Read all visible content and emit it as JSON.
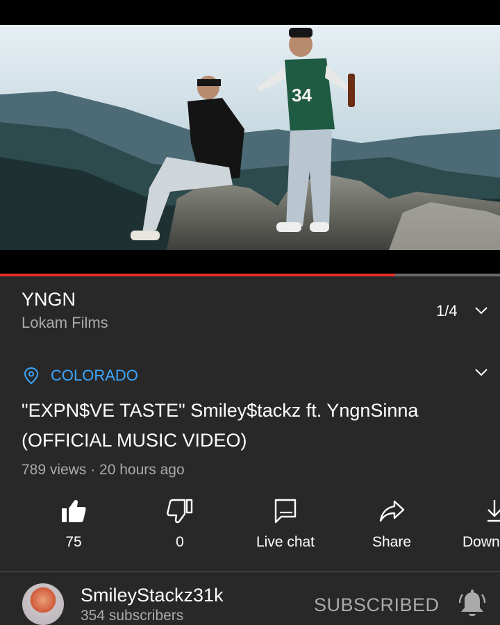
{
  "player": {
    "progress_fraction": 0.79
  },
  "playlist": {
    "title": "YNGN",
    "channel": "Lokam Films",
    "index": "1/4"
  },
  "video": {
    "location": "COLORADO",
    "title": "\"EXPN$VE TASTE\" Smiley$tackz ft. YngnSinna (OFFICIAL MUSIC VIDEO)",
    "meta": "789 views · 20 hours ago"
  },
  "actions": {
    "like": {
      "icon": "thumbs-up-icon",
      "label": "75"
    },
    "dislike": {
      "icon": "thumbs-down-icon",
      "label": "0"
    },
    "live_chat": {
      "icon": "chat-icon",
      "label": "Live chat"
    },
    "share": {
      "icon": "share-icon",
      "label": "Share"
    },
    "download": {
      "icon": "download-icon",
      "label": "Down"
    }
  },
  "channel": {
    "name": "SmileyStackz31k",
    "subscribers": "354 subscribers",
    "subscribe_label": "SUBSCRIBED"
  },
  "colors": {
    "background": "#282828",
    "accent_link": "#3ea6ff",
    "progress": "#e52d27",
    "secondary_text": "#aaaaaa"
  }
}
